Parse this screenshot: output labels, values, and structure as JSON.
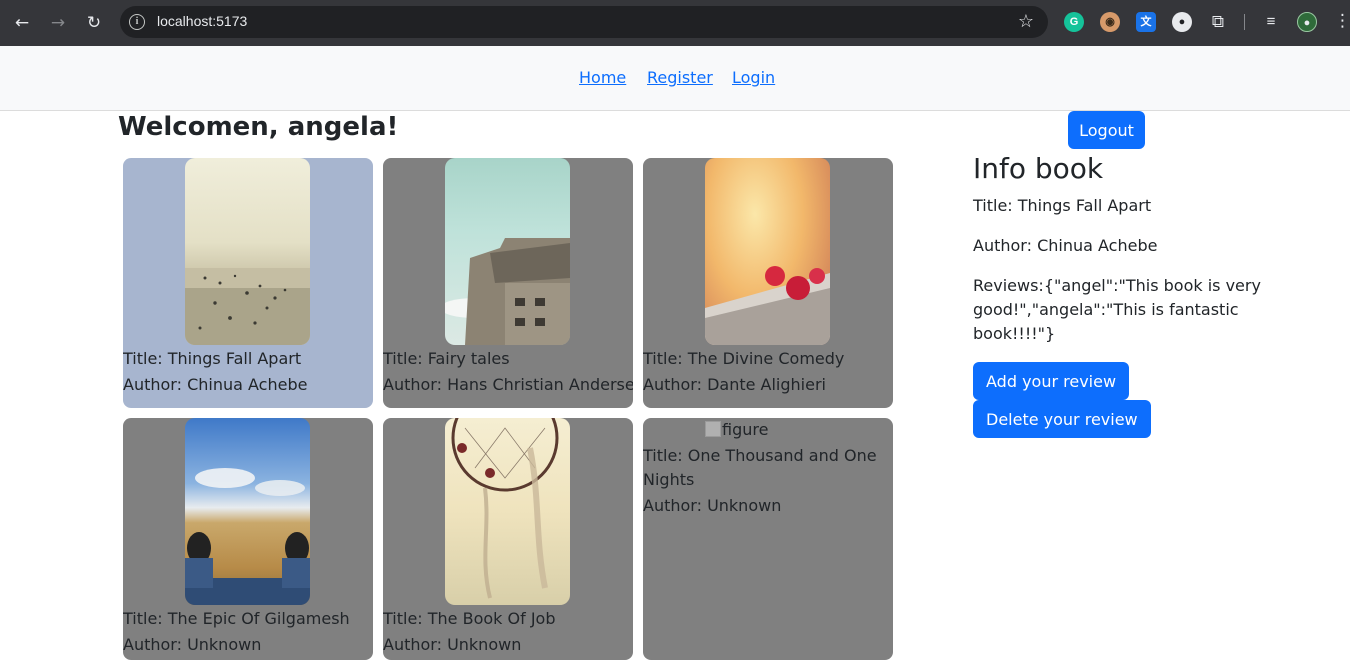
{
  "browser": {
    "url": "localhost:5173",
    "back_icon": "arrow-left-icon",
    "forward_icon": "arrow-right-icon",
    "reload_icon": "reload-icon",
    "extensions": [
      "grammarly-icon",
      "owl-icon",
      "translate-icon",
      "ghost-icon",
      "puzzle-icon",
      "media-icon",
      "profile-avatar"
    ]
  },
  "nav": {
    "home": "Home",
    "register": "Register",
    "login": "Login"
  },
  "header": {
    "welcome": "Welcomen, angela!",
    "logout": "Logout"
  },
  "books": [
    {
      "title": "Title: Things Fall Apart",
      "author": "Author: Chinua Achebe",
      "selected": true
    },
    {
      "title": "Title: Fairy tales",
      "author": "Author: Hans Christian Andersen"
    },
    {
      "title": "Title: The Divine Comedy",
      "author": "Author: Dante Alighieri"
    },
    {
      "title": "Title: The Epic Of Gilgamesh",
      "author": "Author: Unknown"
    },
    {
      "title": "Title: The Book Of Job",
      "author": "Author: Unknown"
    },
    {
      "title": "Title: One Thousand and One Nights",
      "author": "Author: Unknown",
      "image_alt": "figure"
    }
  ],
  "info": {
    "heading": "Info book",
    "title": "Title: Things Fall Apart",
    "author": "Author: Chinua Achebe",
    "reviews": "Reviews:{\"angel\":\"This book is very good!\",\"angela\":\"This is fantastic book!!!!\"}",
    "add_review": "Add your review",
    "delete_review": "Delete your review"
  },
  "colors": {
    "primary": "#0d6efd",
    "card_bg": "#808080",
    "card_selected_bg": "#a7b5cf",
    "chrome_bg": "#35363a"
  }
}
